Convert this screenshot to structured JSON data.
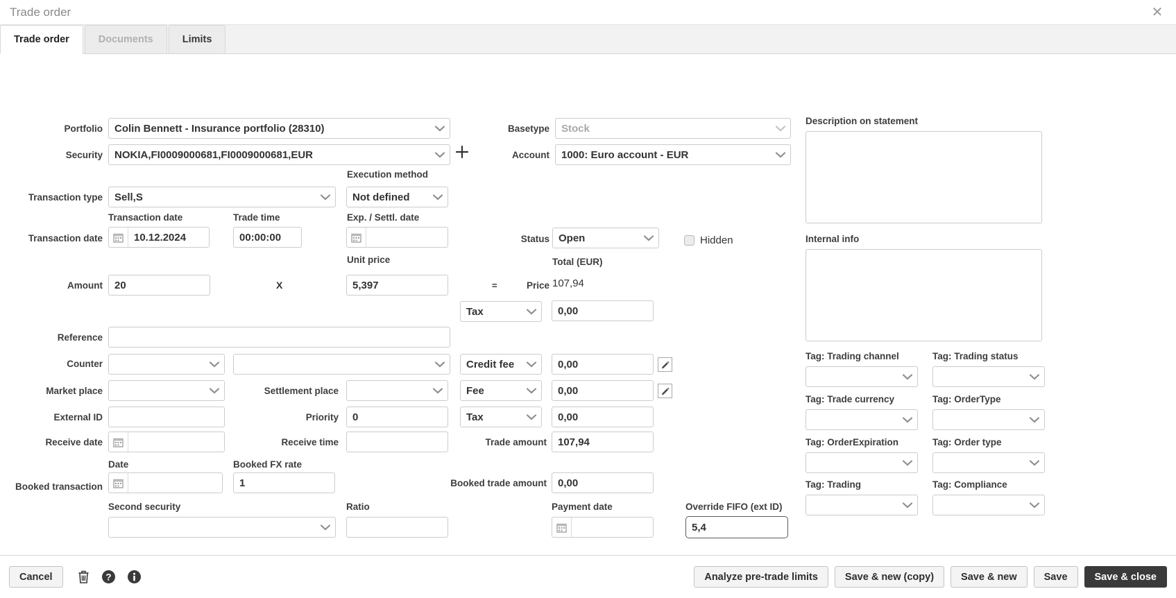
{
  "window": {
    "title": "Trade order",
    "close_icon": "close-icon"
  },
  "tabs": [
    {
      "label": "Trade order",
      "state": "active"
    },
    {
      "label": "Documents",
      "state": "disabled"
    },
    {
      "label": "Limits",
      "state": "inactive"
    }
  ],
  "form": {
    "portfolio": {
      "label": "Portfolio",
      "value": "Colin Bennett - Insurance portfolio (28310)"
    },
    "security": {
      "label": "Security",
      "value": "NOKIA,FI0009000681,FI0009000681,EUR",
      "add_icon": "plus-icon"
    },
    "basetype": {
      "label": "Basetype",
      "value": "Stock"
    },
    "account": {
      "label": "Account",
      "value": "1000: Euro account - EUR"
    },
    "transaction_type": {
      "label": "Transaction type",
      "value": "Sell,S"
    },
    "execution_method": {
      "label": "Execution method",
      "value": "Not defined"
    },
    "transaction_date_row_label": "Transaction date",
    "transaction_date": {
      "label": "Transaction date",
      "value": "10.12.2024"
    },
    "trade_time": {
      "label": "Trade time",
      "value": "00:00:00"
    },
    "exp_settl_date": {
      "label": "Exp. / Settl. date",
      "value": ""
    },
    "status": {
      "label": "Status",
      "value": "Open"
    },
    "hidden": {
      "label": "Hidden",
      "checked": false
    },
    "amount": {
      "label": "Amount",
      "value": "20"
    },
    "multiply_sign": "X",
    "unit_price": {
      "label": "Unit price",
      "value": "5,397"
    },
    "equals_sign": "=",
    "price": {
      "label": "Price",
      "value": "107,94"
    },
    "total_label": "Total (EUR)",
    "tax_top": {
      "type": "Tax",
      "value": "0,00"
    },
    "reference": {
      "label": "Reference",
      "value": ""
    },
    "counter": {
      "label": "Counter",
      "value": "",
      "value2": ""
    },
    "credit_fee": {
      "type": "Credit fee",
      "value": "0,00",
      "edit_icon": "edit-pencil-icon"
    },
    "market_place": {
      "label": "Market place",
      "value": ""
    },
    "settlement_place": {
      "label": "Settlement place",
      "value": ""
    },
    "fee": {
      "type": "Fee",
      "value": "0,00",
      "edit_icon": "edit-pencil-icon"
    },
    "external_id": {
      "label": "External ID",
      "value": ""
    },
    "priority": {
      "label": "Priority",
      "value": "0"
    },
    "tax_bottom": {
      "type": "Tax",
      "value": "0,00"
    },
    "receive_date": {
      "label": "Receive date",
      "value": ""
    },
    "receive_time": {
      "label": "Receive time",
      "value": ""
    },
    "trade_amount": {
      "label": "Trade amount",
      "value": "107,94"
    },
    "booked_transaction_label": "Booked transaction",
    "booked_date": {
      "label": "Date",
      "value": ""
    },
    "booked_fx_rate": {
      "label": "Booked FX rate",
      "value": "1"
    },
    "booked_trade_amount": {
      "label": "Booked trade amount",
      "value": "0,00"
    },
    "second_security": {
      "label": "Second security",
      "value": ""
    },
    "ratio": {
      "label": "Ratio",
      "value": ""
    },
    "payment_date": {
      "label": "Payment date",
      "value": ""
    },
    "override_fifo": {
      "label": "Override FIFO (ext ID)",
      "value": "5,4"
    }
  },
  "side": {
    "description_label": "Description on statement",
    "description_value": "",
    "internal_info_label": "Internal info",
    "internal_info_value": "",
    "tags": [
      {
        "label": "Tag: Trading channel",
        "value": ""
      },
      {
        "label": "Tag: Trading status",
        "value": ""
      },
      {
        "label": "Tag: Trade currency",
        "value": ""
      },
      {
        "label": "Tag: OrderType",
        "value": ""
      },
      {
        "label": "Tag: OrderExpiration",
        "value": ""
      },
      {
        "label": "Tag: Order type",
        "value": ""
      },
      {
        "label": "Tag: Trading",
        "value": ""
      },
      {
        "label": "Tag: Compliance",
        "value": ""
      }
    ]
  },
  "footer": {
    "cancel": "Cancel",
    "delete_icon": "trash-icon",
    "help_icon": "help-circle-icon",
    "info_icon": "info-circle-icon",
    "analyze": "Analyze pre-trade limits",
    "save_new_copy": "Save & new (copy)",
    "save_new": "Save & new",
    "save": "Save",
    "save_close": "Save & close"
  },
  "colors": {
    "primary_button": "#3a3a3a",
    "border": "#cccccc",
    "label_text": "#3d3d3d",
    "muted_text": "#a8a8a8"
  }
}
